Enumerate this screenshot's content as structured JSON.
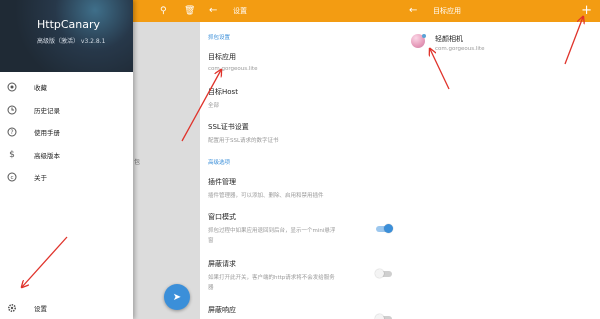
{
  "drawer": {
    "title": "HttpCanary",
    "subtitle": "高级版（激活） v3.2.8.1",
    "menu": [
      {
        "icon": "gear-icon",
        "label": "收藏"
      },
      {
        "icon": "history-icon",
        "label": "历史记录"
      },
      {
        "icon": "help-icon",
        "label": "使用手册"
      },
      {
        "icon": "dollar-icon",
        "label": "高级版本"
      },
      {
        "icon": "copyright-icon",
        "label": "关于"
      }
    ],
    "settings_label": "设置",
    "behind_text": "包",
    "toolbar_icons": [
      "search-icon",
      "delete-icon"
    ]
  },
  "settings": {
    "title": "设置",
    "section_capture": "抓包设置",
    "target_app": {
      "title": "目标应用",
      "sub": "com.gorgeous.lite"
    },
    "target_host": {
      "title": "目标Host",
      "sub": "全部"
    },
    "ssl": {
      "title": "SSL证书设置",
      "sub": "配置用于SSL请求的数字证书"
    },
    "section_advanced": "高级选项",
    "plugins": {
      "title": "插件管理",
      "sub": "插件管理器，可以添加、删除、启用和禁用插件"
    },
    "window_mode": {
      "title": "窗口模式",
      "sub1": "抓包过程中如果应用退回到后台，显示一个mini悬浮",
      "sub2": "窗",
      "enabled": true
    },
    "block_request": {
      "title": "屏蔽请求",
      "sub": "如果打开此开关，客户端的http请求将不会发给服务",
      "sub2": "器",
      "enabled": false
    },
    "block_response": {
      "title": "屏蔽响应",
      "enabled": false
    }
  },
  "target": {
    "title": "目标应用",
    "add_label": "+",
    "app_name": "轻颜相机",
    "app_pkg": "com.gorgeous.lite"
  },
  "colors": {
    "accent": "#f39c12",
    "blue": "#3b8fd9",
    "arrow": "#e0332b"
  }
}
